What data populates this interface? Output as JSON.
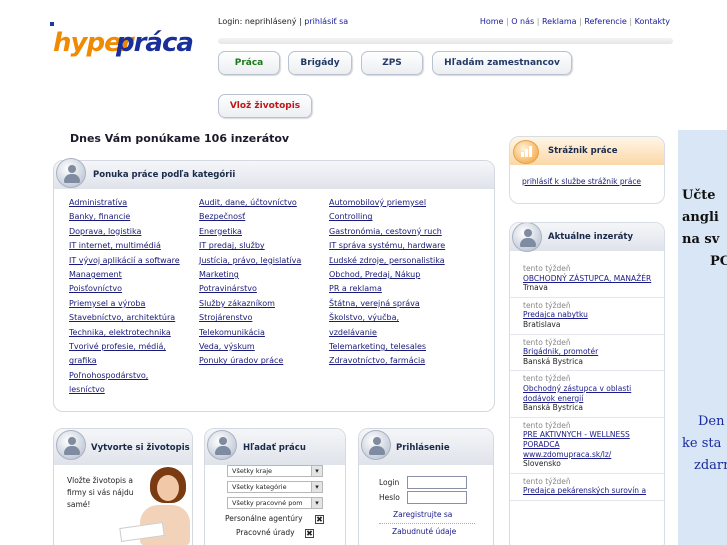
{
  "logo": {
    "part1": "hyper",
    "part2": "práca"
  },
  "topbar": {
    "login_label": "Login: neprihlásený |",
    "login_link": "prihlásiť sa",
    "links": [
      "Home",
      "O nás",
      "Reklama",
      "Referencie",
      "Kontakty"
    ]
  },
  "nav": {
    "praca": "Práca",
    "brigady": "Brigády",
    "zps": "ZPS",
    "hladam": "Hľadám zamestnancov",
    "vloz": "Vlož životopis"
  },
  "headline": "Dnes Vám ponúkame 106 inzerátov",
  "categories": {
    "title": "Ponuka práce podľa kategórii",
    "col1": [
      "Administratíva",
      "Banky, financie",
      "Doprava, logistika",
      "IT internet, multimédiá",
      "IT vývoj aplikácií a software",
      "Management",
      "Poisťovníctvo",
      "Priemysel a výroba",
      "Stavebníctvo, architektúra",
      "Technika, elektrotechnika",
      "Tvorivé profesie, médiá,",
      "grafika",
      "Poľnohospodárstvo,",
      "lesníctvo"
    ],
    "col2": [
      "Audit, dane, účtovníctvo",
      "Bezpečnosť",
      "Energetika",
      "IT predaj, služby",
      "Justícia, právo, legislatíva",
      "Marketing",
      "Potravinárstvo",
      "Služby zákazníkom",
      "Strojárenstvo",
      "Telekomunikácia",
      "Veda, výskum",
      "Ponuky úradov práce"
    ],
    "col3": [
      "Automobilový priemysel",
      "Controlling",
      "Gastronómia, cestovný ruch",
      "IT správa systému, hardware",
      "Ľudské zdroje, personalistika",
      "Obchod, Predaj, Nákup",
      "PR a reklama",
      "Štátna, verejná správa",
      "Školstvo, výučba,",
      "vzdelávanie",
      "Telemarketing, telesales",
      "Zdravotníctvo, farmácia"
    ]
  },
  "strazhnik": {
    "title": "Strážnik práce",
    "link": "prihlásiť k službe strážnik práce"
  },
  "aktualne": {
    "title": "Aktuálne inzeráty",
    "items": [
      {
        "when": "tento týždeň",
        "title": "OBCHODNÝ ZÁSTUPCA, MANAŽÉR",
        "extra": "",
        "loc": "Trnava"
      },
      {
        "when": "tento týždeň",
        "title": "Predajca nabytku",
        "extra": "",
        "loc": "Bratislava"
      },
      {
        "when": "tento týždeň",
        "title": "Brigádnik, promotér",
        "extra": "",
        "loc": "Banská Bystrica"
      },
      {
        "when": "tento týždeň",
        "title": "Obchodný zástupca v oblasti dodávok energií",
        "extra": "",
        "loc": "Banská Bystrica"
      },
      {
        "when": "tento týždeň",
        "title": "PRE AKTIVNYCH - WELLNESS PORADCA",
        "extra": "www.zdomupraca.sk/lz/",
        "loc": "Slovensko"
      },
      {
        "when": "tento týždeň",
        "title": "Predajca pekárenských surovín a",
        "extra": "",
        "loc": ""
      }
    ]
  },
  "zivotopis": {
    "title": "Vytvorte si životopis",
    "text": [
      "Vložte životopis a",
      "firmy si vás nájdu",
      "samé!"
    ]
  },
  "hladat": {
    "title": "Hľadať prácu",
    "selects": [
      "Všetky kraje",
      "Všetky kategórie",
      "Všetky pracovné pom"
    ],
    "checks": [
      "Personálne agentúry",
      "Pracovné úrady"
    ],
    "check_mark": "✖"
  },
  "prihlasenie": {
    "title": "Prihlásenie",
    "login_label": "Login",
    "heslo_label": "Heslo",
    "register": "Zaregistrujte sa",
    "forgot": "Zabudnuté údaje"
  },
  "ad": {
    "lines": [
      "Učte",
      "angli",
      "na sv",
      "PC"
    ],
    "blue_lines": [
      "Den",
      "ke sta",
      "zdarr"
    ]
  }
}
